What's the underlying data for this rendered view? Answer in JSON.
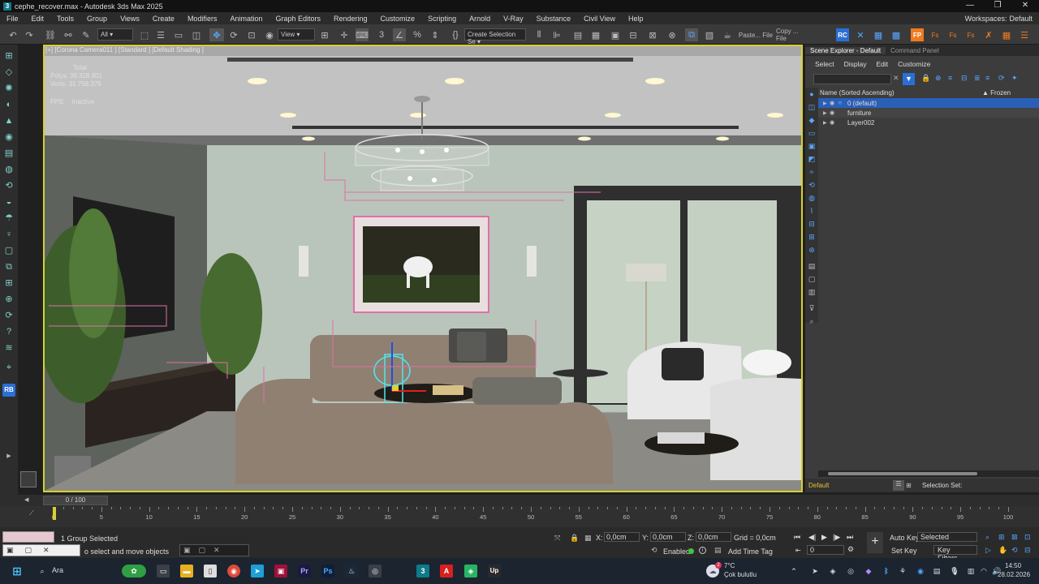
{
  "titlebar": {
    "title": "cephe_recover.max - Autodesk 3ds Max 2025",
    "min": "—",
    "restore": "❐",
    "close": "✕"
  },
  "menu": [
    "File",
    "Edit",
    "Tools",
    "Group",
    "Views",
    "Create",
    "Modifiers",
    "Animation",
    "Graph Editors",
    "Rendering",
    "Customize",
    "Scripting",
    "Arnold",
    "V-Ray",
    "Substance",
    "Civil View",
    "Help"
  ],
  "workspace": {
    "label": "Workspaces:",
    "value": "Default"
  },
  "toolbar": {
    "filter": "All",
    "view": "View",
    "create_selection": "Create Selection Se",
    "paste": "Paste... File",
    "copy": "Copy ... File"
  },
  "viewport": {
    "label": "[+] [Corona Camera011 ] [Standard ] [Default Shading ]",
    "stats_header": "Total",
    "polys_label": "Polys:",
    "polys_value": "39.328.801",
    "verts_label": "Verts:",
    "verts_value": "31.758.379",
    "fps_label": "FPS:",
    "fps_value": "Inactive"
  },
  "scene_explorer": {
    "tab_active": "Scene Explorer - Default",
    "tab_other": "Command Panel",
    "menu": [
      "Select",
      "Display",
      "Edit",
      "Customize"
    ],
    "col_name": "Name (Sorted Ascending)",
    "col_frozen": "▲ Frozen",
    "layers": [
      {
        "name": "0 (default)"
      },
      {
        "name": "furniture"
      },
      {
        "name": "Layer002"
      }
    ],
    "layer_dropdown": "Default",
    "selection_set": "Selection Set:"
  },
  "timeline": {
    "slider": "0 / 100",
    "ticks": [
      "0",
      "5",
      "10",
      "15",
      "20",
      "25",
      "30",
      "35",
      "40",
      "45",
      "50",
      "55",
      "60",
      "65",
      "70",
      "75",
      "80",
      "85",
      "90",
      "95",
      "100"
    ]
  },
  "status": {
    "selected": "1 Group Selected",
    "hint": "Click or click-and-drag to select and move objects",
    "x_label": "X:",
    "x": "0,0cm",
    "y_label": "Y:",
    "y": "0,0cm",
    "z_label": "Z:",
    "z": "0,0cm",
    "grid": "Grid = 0,0cm",
    "enabled": "Enabled:",
    "add_time_tag": "Add Time Tag",
    "auto_key": "Auto Key",
    "set_key": "Set Key",
    "key_mode": "Selected",
    "key_filters": "Key Filters...",
    "frame": "0"
  },
  "taskbar": {
    "search": "Ara",
    "weather_temp": "7°C",
    "weather_desc": "Çok bulutlu",
    "time": "14:50",
    "date": "28.02.2026",
    "notification": "2"
  },
  "colors": {
    "accent_blue": "#58a6ff",
    "orange": "#f07a1e",
    "viewport_border": "#d8d030",
    "selection_pink": "#e070a8"
  }
}
